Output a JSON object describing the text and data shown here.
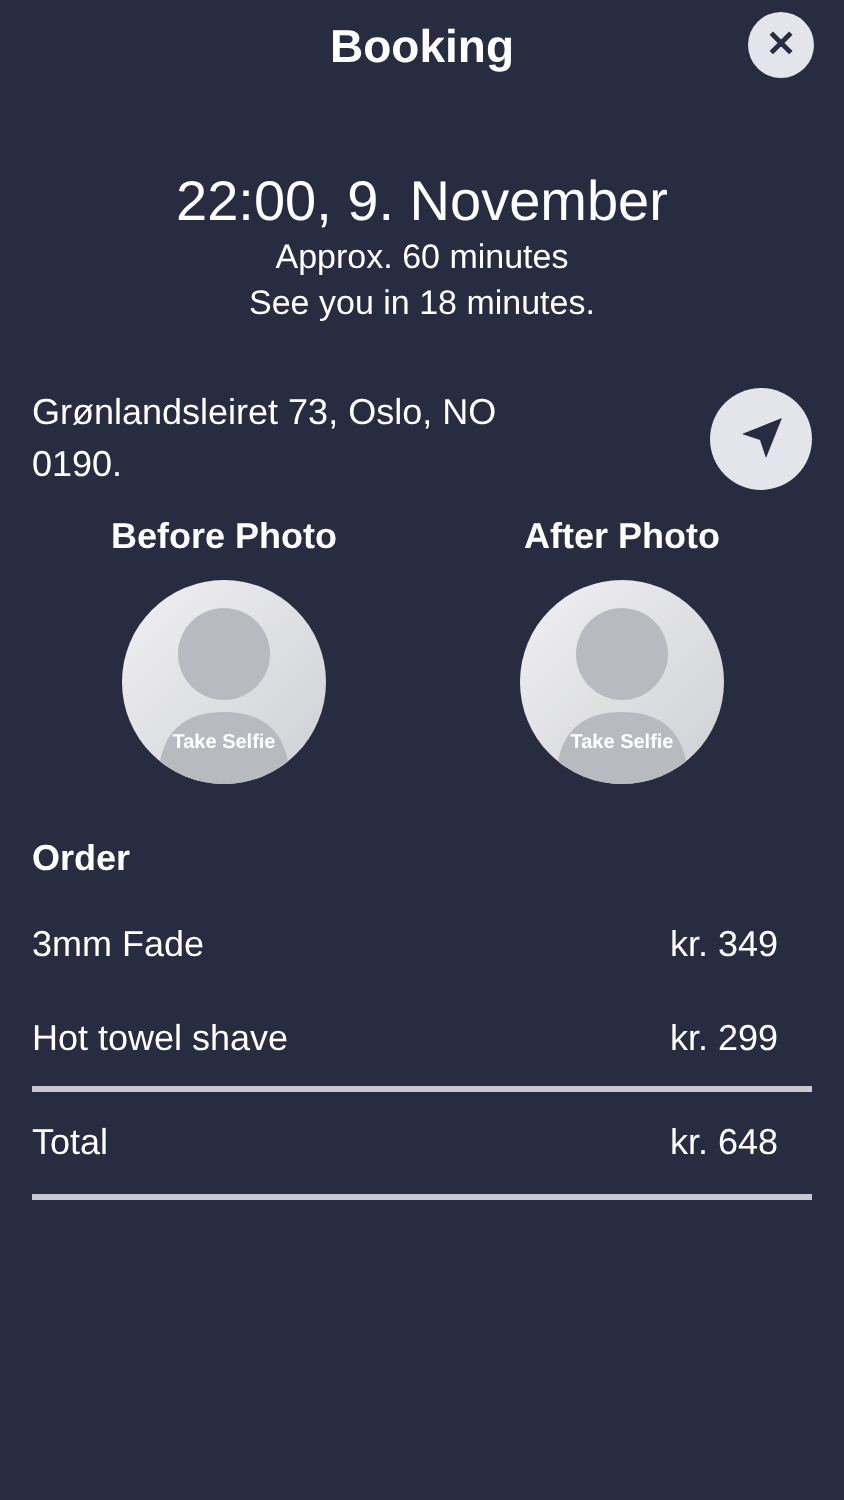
{
  "header": {
    "title": "Booking",
    "close": "✕"
  },
  "appointment": {
    "datetime": "22:00, 9. November",
    "duration": "Approx. 60 minutes",
    "countdown": "See you in 18 minutes."
  },
  "address": "Grønlandsleiret 73, Oslo, NO 0190.",
  "photos": [
    {
      "heading": "Before Photo",
      "button": "Take Selfie"
    },
    {
      "heading": "After Photo",
      "button": "Take Selfie"
    }
  ],
  "order": {
    "heading": "Order",
    "items": [
      {
        "name": "3mm Fade",
        "price": "kr. 349"
      },
      {
        "name": "Hot towel shave",
        "price": "kr. 299"
      }
    ],
    "total": {
      "label": "Total",
      "price": "kr. 648"
    }
  }
}
